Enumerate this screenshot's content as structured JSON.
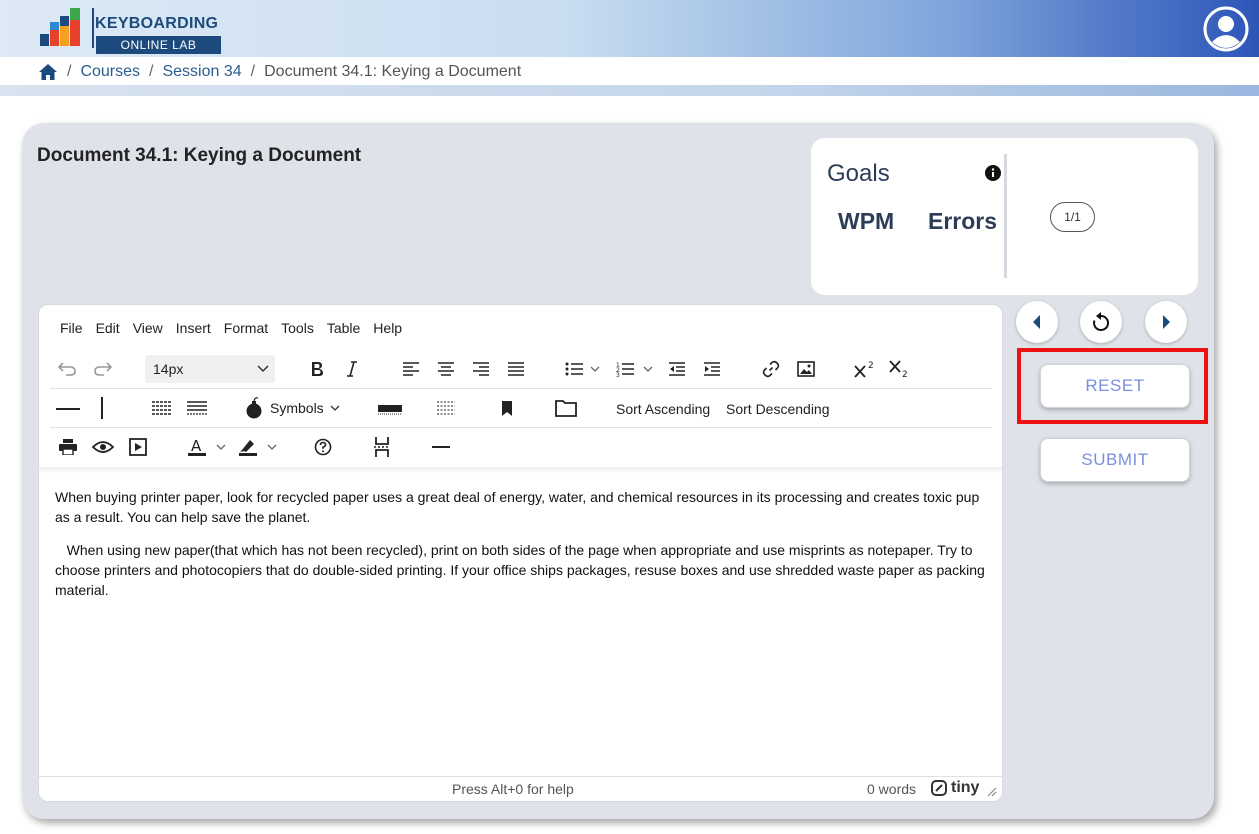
{
  "brand": {
    "line1": "KEYBOARDING",
    "line2": "ONLINE LAB"
  },
  "breadcrumb": {
    "home": "home-icon",
    "items": [
      "Courses",
      "Session 34"
    ],
    "current": "Document 34.1: Keying a Document"
  },
  "document": {
    "title": "Document 34.1: Keying a Document"
  },
  "goals": {
    "title": "Goals",
    "wpm_label": "WPM",
    "errors_label": "Errors",
    "pager": "1/1"
  },
  "buttons": {
    "reset": "RESET",
    "submit": "SUBMIT"
  },
  "editor": {
    "menu": [
      "File",
      "Edit",
      "View",
      "Insert",
      "Format",
      "Tools",
      "Table",
      "Help"
    ],
    "font_size": "14px",
    "symbols_label": "Symbols",
    "sort_asc": "Sort Ascending",
    "sort_desc": "Sort Descending",
    "paragraphs": [
      "When buying printer paper, look for recycled paper uses a great deal of energy, water, and chemical resources in its processing and creates toxic pup as a result. You can help save the planet.",
      "   When using new paper(that which has not been recycled), print on both sides of the page when appropriate and use misprints as notepaper. Try to choose printers and photocopiers that do double-sided printing. If your office ships packages, resuse boxes and use shredded waste paper as packing material."
    ],
    "status_help": "Press Alt+0 for help",
    "word_count": "0 words",
    "brand": "tiny"
  },
  "colors": {
    "accent": "#7a8fe0",
    "highlight": "#ee1111",
    "brand_blue": "#1d4a7c"
  }
}
